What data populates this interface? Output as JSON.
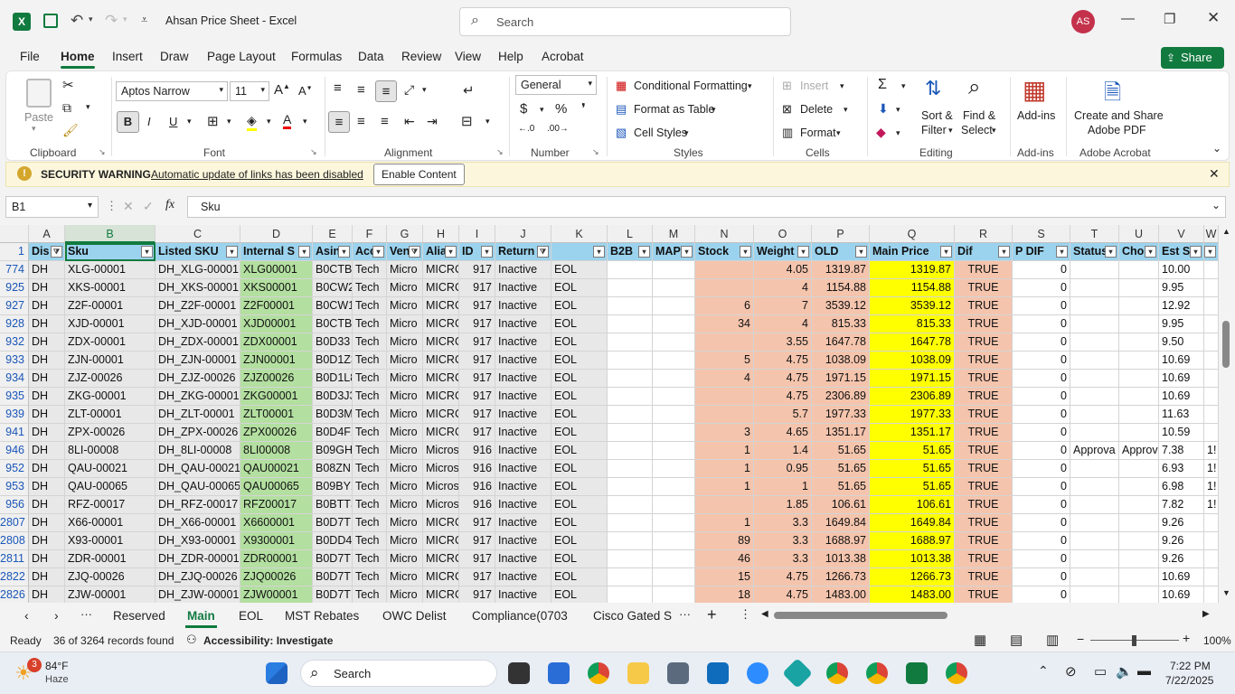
{
  "window": {
    "title": "Ahsan Price Sheet  -  Excel",
    "search_placeholder": "Search",
    "avatar": "AS"
  },
  "menu": [
    "File",
    "Home",
    "Insert",
    "Draw",
    "Page Layout",
    "Formulas",
    "Data",
    "Review",
    "View",
    "Help",
    "Acrobat"
  ],
  "share_label": "Share",
  "ribbon": {
    "paste": "Paste",
    "font_name": "Aptos Narrow",
    "font_size": "11",
    "number_format": "General",
    "conditional_formatting": "Conditional Formatting",
    "format_as_table": "Format as Table",
    "cell_styles": "Cell Styles",
    "insert": "Insert",
    "delete": "Delete",
    "format": "Format",
    "sort_filter": "Sort &",
    "sort_filter2": "Filter",
    "find_select": "Find &",
    "find_select2": "Select",
    "addins": "Add-ins",
    "create_share": "Create and Share",
    "adobe_pdf": "Adobe PDF",
    "groups": {
      "clipboard": "Clipboard",
      "font": "Font",
      "alignment": "Alignment",
      "number": "Number",
      "styles": "Styles",
      "cells": "Cells",
      "editing": "Editing",
      "addins": "Add-ins",
      "acrobat": "Adobe Acrobat"
    }
  },
  "security": {
    "label": "SECURITY WARNING",
    "message": "Automatic update of links has been disabled",
    "button": "Enable Content"
  },
  "formula_bar": {
    "name_box": "B1",
    "formula": "Sku"
  },
  "columns": [
    "A",
    "B",
    "C",
    "D",
    "E",
    "F",
    "G",
    "H",
    "I",
    "J",
    "K",
    "L",
    "M",
    "N",
    "O",
    "P",
    "Q",
    "R",
    "S",
    "T",
    "U",
    "V",
    "W"
  ],
  "header_row": [
    "Dis",
    "Sku",
    "Listed SKU",
    "Internal S",
    "Asin",
    "Acc",
    "Ven",
    "Alia",
    "ID",
    "Return",
    "",
    "B2B",
    "MAP",
    "Stock",
    "Weight",
    "OLD",
    "Main Price",
    "Dif",
    "P DIF",
    "Status",
    "Cho",
    "Est S",
    "S"
  ],
  "rows": [
    {
      "n": "774",
      "c": [
        "DH",
        "XLG-00001",
        "DH_XLG-00001",
        "XLG00001",
        "B0CTB5",
        "Tech",
        "Micro",
        "MICRO",
        "917",
        "Inactive",
        "EOL",
        "",
        "",
        "",
        "4.05",
        "1319.87",
        "1319.87",
        "TRUE",
        "0",
        "",
        "",
        "10.00",
        ""
      ]
    },
    {
      "n": "925",
      "c": [
        "DH",
        "XKS-00001",
        "DH_XKS-00001",
        "XKS00001",
        "B0CW2",
        "Tech",
        "Micro",
        "MICRO",
        "917",
        "Inactive",
        "EOL",
        "",
        "",
        "",
        "4",
        "1154.88",
        "1154.88",
        "TRUE",
        "0",
        "",
        "",
        "9.95",
        ""
      ]
    },
    {
      "n": "927",
      "c": [
        "DH",
        "Z2F-00001",
        "DH_Z2F-00001",
        "Z2F00001",
        "B0CW1",
        "Tech",
        "Micro",
        "MICRO",
        "917",
        "Inactive",
        "EOL",
        "",
        "",
        "6",
        "7",
        "3539.12",
        "3539.12",
        "TRUE",
        "0",
        "",
        "",
        "12.92",
        ""
      ]
    },
    {
      "n": "928",
      "c": [
        "DH",
        "XJD-00001",
        "DH_XJD-00001",
        "XJD00001",
        "B0CTB3",
        "Tech",
        "Micro",
        "MICRO",
        "917",
        "Inactive",
        "EOL",
        "",
        "",
        "34",
        "4",
        "815.33",
        "815.33",
        "TRUE",
        "0",
        "",
        "",
        "9.95",
        ""
      ]
    },
    {
      "n": "932",
      "c": [
        "DH",
        "ZDX-00001",
        "DH_ZDX-00001",
        "ZDX00001",
        "B0D33",
        "Tech",
        "Micro",
        "MICRO",
        "917",
        "Inactive",
        "EOL",
        "",
        "",
        "",
        "3.55",
        "1647.78",
        "1647.78",
        "TRUE",
        "0",
        "",
        "",
        "9.50",
        ""
      ]
    },
    {
      "n": "933",
      "c": [
        "DH",
        "ZJN-00001",
        "DH_ZJN-00001",
        "ZJN00001",
        "B0D1Z3",
        "Tech",
        "Micro",
        "MICRO",
        "917",
        "Inactive",
        "EOL",
        "",
        "",
        "5",
        "4.75",
        "1038.09",
        "1038.09",
        "TRUE",
        "0",
        "",
        "",
        "10.69",
        ""
      ]
    },
    {
      "n": "934",
      "c": [
        "DH",
        "ZJZ-00026",
        "DH_ZJZ-00026",
        "ZJZ00026",
        "B0D1L8",
        "Tech",
        "Micro",
        "MICRO",
        "917",
        "Inactive",
        "EOL",
        "",
        "",
        "4",
        "4.75",
        "1971.15",
        "1971.15",
        "TRUE",
        "0",
        "",
        "",
        "10.69",
        ""
      ]
    },
    {
      "n": "935",
      "c": [
        "DH",
        "ZKG-00001",
        "DH_ZKG-00001",
        "ZKG00001",
        "B0D3J3",
        "Tech",
        "Micro",
        "MICRO",
        "917",
        "Inactive",
        "EOL",
        "",
        "",
        "",
        "4.75",
        "2306.89",
        "2306.89",
        "TRUE",
        "0",
        "",
        "",
        "10.69",
        ""
      ]
    },
    {
      "n": "939",
      "c": [
        "DH",
        "ZLT-00001",
        "DH_ZLT-00001",
        "ZLT00001",
        "B0D3M",
        "Tech",
        "Micro",
        "MICRO",
        "917",
        "Inactive",
        "EOL",
        "",
        "",
        "",
        "5.7",
        "1977.33",
        "1977.33",
        "TRUE",
        "0",
        "",
        "",
        "11.63",
        ""
      ]
    },
    {
      "n": "941",
      "c": [
        "DH",
        "ZPX-00026",
        "DH_ZPX-00026",
        "ZPX00026",
        "B0D4F1",
        "Tech",
        "Micro",
        "MICRO",
        "917",
        "Inactive",
        "EOL",
        "",
        "",
        "3",
        "4.65",
        "1351.17",
        "1351.17",
        "TRUE",
        "0",
        "",
        "",
        "10.59",
        ""
      ]
    },
    {
      "n": "946",
      "c": [
        "DH",
        "8LI-00008",
        "DH_8LI-00008",
        "8LI00008",
        "B09GH",
        "Tech",
        "Micro",
        "Micros",
        "916",
        "Inactive",
        "EOL",
        "",
        "",
        "1",
        "1.4",
        "51.65",
        "51.65",
        "TRUE",
        "0",
        "Approva",
        "Approv",
        "7.38",
        "1!"
      ]
    },
    {
      "n": "952",
      "c": [
        "DH",
        "QAU-00021",
        "DH_QAU-00021",
        "QAU00021",
        "B08ZN",
        "Tech",
        "Micro",
        "Micros",
        "916",
        "Inactive",
        "EOL",
        "",
        "",
        "1",
        "0.95",
        "51.65",
        "51.65",
        "TRUE",
        "0",
        "",
        "",
        "6.93",
        "1!"
      ]
    },
    {
      "n": "953",
      "c": [
        "DH",
        "QAU-00065",
        "DH_QAU-00065",
        "QAU00065",
        "B09BY1",
        "Tech",
        "Micro",
        "Micros",
        "916",
        "Inactive",
        "EOL",
        "",
        "",
        "1",
        "1",
        "51.65",
        "51.65",
        "TRUE",
        "0",
        "",
        "",
        "6.98",
        "1!"
      ]
    },
    {
      "n": "956",
      "c": [
        "DH",
        "RFZ-00017",
        "DH_RFZ-00017",
        "RFZ00017",
        "B0BTTS",
        "Tech",
        "Micro",
        "Micros",
        "916",
        "Inactive",
        "EOL",
        "",
        "",
        "",
        "1.85",
        "106.61",
        "106.61",
        "TRUE",
        "0",
        "",
        "",
        "7.82",
        "1!"
      ]
    },
    {
      "n": "2807",
      "c": [
        "DH",
        "X66-00001",
        "DH_X66-00001",
        "X6600001",
        "B0D7T",
        "Tech",
        "Micro",
        "MICRO",
        "917",
        "Inactive",
        "EOL",
        "",
        "",
        "1",
        "3.3",
        "1649.84",
        "1649.84",
        "TRUE",
        "0",
        "",
        "",
        "9.26",
        ""
      ]
    },
    {
      "n": "2808",
      "c": [
        "DH",
        "X93-00001",
        "DH_X93-00001",
        "X9300001",
        "B0DD4",
        "Tech",
        "Micro",
        "MICRO",
        "917",
        "Inactive",
        "EOL",
        "",
        "",
        "89",
        "3.3",
        "1688.97",
        "1688.97",
        "TRUE",
        "0",
        "",
        "",
        "9.26",
        ""
      ]
    },
    {
      "n": "2811",
      "c": [
        "DH",
        "ZDR-00001",
        "DH_ZDR-00001",
        "ZDR00001",
        "B0D7T",
        "Tech",
        "Micro",
        "MICRO",
        "917",
        "Inactive",
        "EOL",
        "",
        "",
        "46",
        "3.3",
        "1013.38",
        "1013.38",
        "TRUE",
        "0",
        "",
        "",
        "9.26",
        ""
      ]
    },
    {
      "n": "2822",
      "c": [
        "DH",
        "ZJQ-00026",
        "DH_ZJQ-00026",
        "ZJQ00026",
        "B0D7T",
        "Tech",
        "Micro",
        "MICRO",
        "917",
        "Inactive",
        "EOL",
        "",
        "",
        "15",
        "4.75",
        "1266.73",
        "1266.73",
        "TRUE",
        "0",
        "",
        "",
        "10.69",
        ""
      ]
    },
    {
      "n": "2826",
      "c": [
        "DH",
        "ZJW-00001",
        "DH_ZJW-00001",
        "ZJW00001",
        "B0D7T",
        "Tech",
        "Micro",
        "MICRO",
        "917",
        "Inactive",
        "EOL",
        "",
        "",
        "18",
        "4.75",
        "1483.00",
        "1483.00",
        "TRUE",
        "0",
        "",
        "",
        "10.69",
        ""
      ]
    }
  ],
  "sheet_tabs": [
    "Reserved",
    "Main",
    "EOL",
    "MST Rebates",
    "OWC Delist",
    "Compliance(0703",
    "Cisco Gated S"
  ],
  "active_tab": "Main",
  "status": {
    "ready": "Ready",
    "records": "36 of 3264 records found",
    "accessibility": "Accessibility: Investigate",
    "zoom": "100%"
  },
  "taskbar": {
    "temp": "84°F",
    "weather": "Haze",
    "search": "Search",
    "time": "7:22 PM",
    "date": "7/22/2025",
    "badge": "3"
  },
  "colors": {
    "excel_green": "#117a3f",
    "header_blue": "#9bd3ee",
    "green_cell": "#b3dfa0",
    "salmon_cell": "#f4c4ad",
    "yellow_cell": "#ffff00"
  }
}
